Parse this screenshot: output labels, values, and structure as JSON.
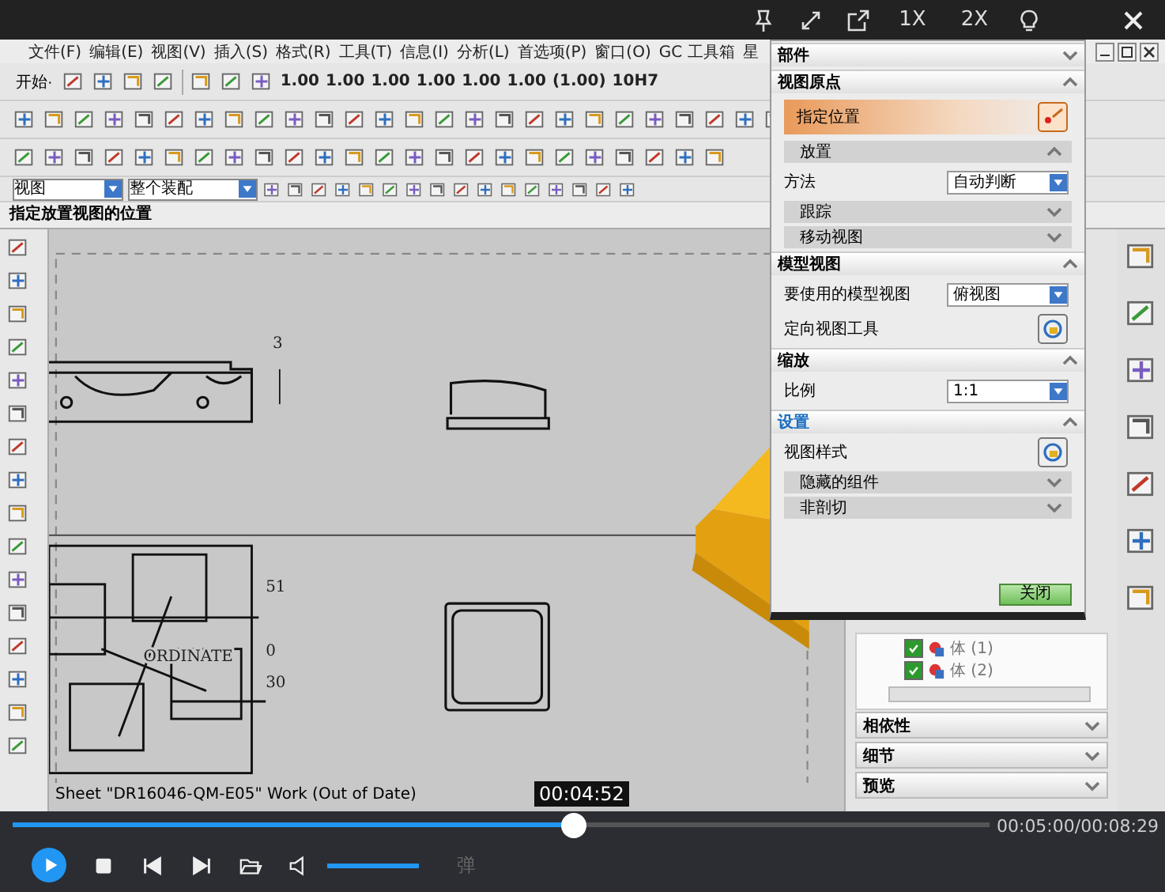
{
  "player": {
    "speed_buttons": [
      "1X",
      "2X"
    ],
    "tooltip": "00:04:52",
    "level": 0.574,
    "time": "00:05:00/00:08:29",
    "playing": false,
    "volume": {
      "level": 1.0
    },
    "danmaku": "弹"
  },
  "app": {
    "menu": [
      "文件(F)",
      "编辑(E)",
      "视图(V)",
      "插入(S)",
      "格式(R)",
      "工具(T)",
      "信息(I)",
      "分析(L)",
      "首选项(P)",
      "窗口(O)",
      "GC 工具箱",
      "星"
    ],
    "start_button": "开始·",
    "dimension_styles": [
      "1.00",
      "1.00",
      "1.00",
      "1.00",
      "1.00",
      "1.00",
      "(1.00)",
      "10H7"
    ],
    "view_dropdown": "视图",
    "assembly_dropdown": "整个装配",
    "prompt": "指定放置视图的位置",
    "canvas": {
      "labels": [
        "3",
        "51",
        "ORDINATE",
        "0",
        "30"
      ],
      "status": "Sheet \"DR16046-QM-E05\" Work (Out of Date)"
    },
    "dialog": {
      "rows": [
        {
          "kind": "header",
          "title": "部件",
          "expanded": false,
          "focused": false
        },
        {
          "kind": "header",
          "title": "视图原点",
          "expanded": true,
          "focused": false
        },
        {
          "kind": "selector",
          "label": "指定位置",
          "selected": true
        },
        {
          "kind": "subheader",
          "title": "放置",
          "expanded": true
        },
        {
          "kind": "dropdown",
          "label": "方法",
          "value": "自动判断"
        },
        {
          "kind": "subheader",
          "title": "跟踪",
          "expanded": false
        },
        {
          "kind": "subheader",
          "title": "移动视图",
          "expanded": false
        },
        {
          "kind": "header",
          "title": "模型视图",
          "expanded": true,
          "focused": false
        },
        {
          "kind": "dropdown",
          "label": "要使用的模型视图",
          "value": "俯视图"
        },
        {
          "kind": "tool",
          "label": "定向视图工具"
        },
        {
          "kind": "header",
          "title": "缩放",
          "expanded": true,
          "focused": false
        },
        {
          "kind": "dropdown",
          "label": "比例",
          "value": "1:1"
        },
        {
          "kind": "header",
          "title": "设置",
          "expanded": true,
          "focused": true
        },
        {
          "kind": "tool",
          "label": "视图样式"
        },
        {
          "kind": "subheader",
          "title": "隐藏的组件",
          "expanded": false
        },
        {
          "kind": "subheader",
          "title": "非剖切",
          "expanded": false
        }
      ],
      "close_button": "关闭"
    },
    "panel": {
      "tree_items": [
        {
          "label": "体 (1)",
          "checked": true
        },
        {
          "label": "体 (2)",
          "checked": true
        }
      ],
      "sections": [
        {
          "title": "相依性",
          "expanded": false
        },
        {
          "title": "细节",
          "expanded": false
        },
        {
          "title": "预览",
          "expanded": false
        }
      ]
    }
  }
}
